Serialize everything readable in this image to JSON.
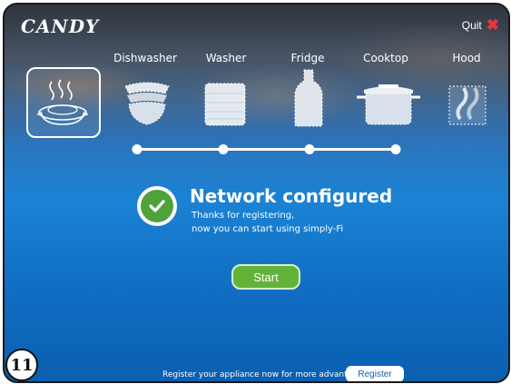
{
  "header": {
    "logo": "CANDY",
    "quit_label": "Quit",
    "quit_icon": "close-x-icon"
  },
  "categories": [
    {
      "label": "",
      "icon": "dish-plate-icon",
      "selected": true
    },
    {
      "label": "Dishwasher",
      "icon": "bowls-stack-icon",
      "selected": false
    },
    {
      "label": "Washer",
      "icon": "towels-stack-icon",
      "selected": false
    },
    {
      "label": "Fridge",
      "icon": "bottle-icon",
      "selected": false
    },
    {
      "label": "Cooktop",
      "icon": "pot-icon",
      "selected": false
    },
    {
      "label": "Hood",
      "icon": "steam-icon",
      "selected": false
    }
  ],
  "progress": {
    "steps": 4,
    "completed": 4
  },
  "status": {
    "title": "Network configured",
    "line1": "Thanks for registering,",
    "line2": "now you can start using simply-Fi",
    "icon": "checkmark-icon"
  },
  "start_label": "Start",
  "footer": {
    "register_text": "Register your appliance now for more advantages",
    "register_label": "Register"
  },
  "step_number": "11",
  "colors": {
    "accent_green": "#63b33a",
    "quit_red": "#e53a3a",
    "background_blue": "#1b82d4"
  }
}
